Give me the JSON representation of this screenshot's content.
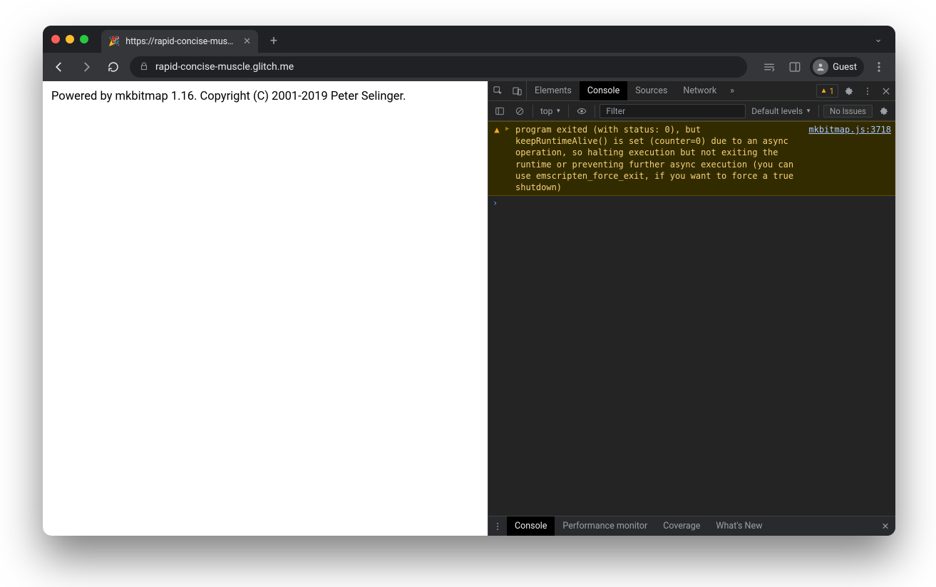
{
  "titlebar": {
    "tab_title": "https://rapid-concise-muscle.g",
    "favicon": "🎉"
  },
  "toolbar": {
    "url": "rapid-concise-muscle.glitch.me",
    "profile_label": "Guest"
  },
  "page": {
    "body_text": "Powered by mkbitmap 1.16. Copyright (C) 2001-2019 Peter Selinger."
  },
  "devtools": {
    "tabs": {
      "elements": "Elements",
      "console": "Console",
      "sources": "Sources",
      "network": "Network"
    },
    "warning_count": "1",
    "filterbar": {
      "context": "top",
      "filter_placeholder": "Filter",
      "levels_label": "Default levels",
      "issues_label": "No Issues"
    },
    "log": {
      "warning_text": "program exited (with status: 0), but keepRuntimeAlive() is set (counter=0) due to an async operation, so halting execution but not exiting the runtime or preventing further async execution (you can use emscripten_force_exit, if you want to force a true shutdown)",
      "source_link": "mkbitmap.js:3718"
    },
    "drawer": {
      "console": "Console",
      "perf": "Performance monitor",
      "coverage": "Coverage",
      "whatsnew": "What's New"
    }
  }
}
